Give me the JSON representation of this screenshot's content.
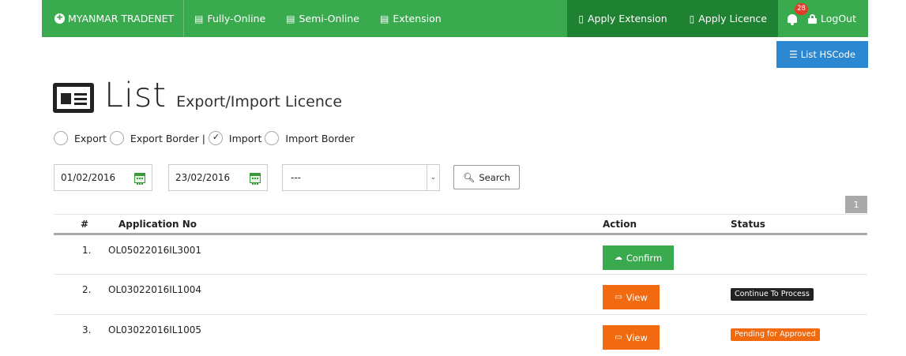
{
  "nav": {
    "brand": "MYANMAR TRADENET",
    "links": [
      {
        "label": "Fully-Online",
        "icon": "document-icon"
      },
      {
        "label": "Semi-Online",
        "icon": "document-icon"
      },
      {
        "label": "Extension",
        "icon": "document-icon"
      }
    ],
    "right": {
      "apply_extension": "Apply Extension",
      "apply_licence": "Apply Licence",
      "notification_count": "28",
      "logout": "LogOut"
    }
  },
  "list_hscode_label": "List HSCode",
  "title": {
    "main": "List",
    "sub": "Export/Import Licence"
  },
  "radios": [
    {
      "label": "Export",
      "checked": false
    },
    {
      "label": "Export Border |",
      "checked": false
    },
    {
      "label": "Import",
      "checked": true
    },
    {
      "label": "Import Border",
      "checked": false
    }
  ],
  "filters": {
    "from_date": "01/02/2016",
    "to_date": "23/02/2016",
    "select_value": "---",
    "search_label": "Search"
  },
  "pager": {
    "current": "1"
  },
  "table": {
    "headers": {
      "num": "#",
      "app": "Application No",
      "action": "Action",
      "status": "Status"
    },
    "rows": [
      {
        "num": "1.",
        "app": "OL05022016IL3001",
        "action": "Confirm",
        "status": ""
      },
      {
        "num": "2.",
        "app": "OL03022016IL1004",
        "action": "View",
        "status": "Continue To Process"
      },
      {
        "num": "3.",
        "app": "OL03022016IL1005",
        "action": "View",
        "status": "Pending for Approved"
      }
    ]
  },
  "colors": {
    "nav_green": "#3aaa4f",
    "nav_dark_green": "#1f8132",
    "blue": "#2c87d1",
    "orange": "#f26a0f",
    "status_black": "#222222",
    "status_orange": "#f26a0f"
  }
}
